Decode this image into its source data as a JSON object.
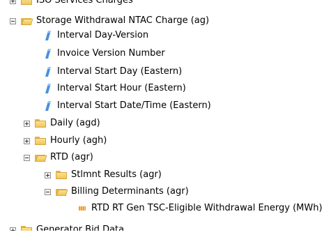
{
  "tree": {
    "top_partial": "ISO Services Charges",
    "storage_folder": "Storage Withdrawal NTAC Charge (ag)",
    "attributes": [
      "Interval Day-Version",
      "Invoice Version Number",
      "Interval Start Day (Eastern)",
      "Interval Start Hour (Eastern)",
      "Interval Start Date/Time (Eastern)"
    ],
    "daily": "Daily (agd)",
    "hourly": "Hourly (agh)",
    "rtd": "RTD (agr)",
    "stlmnt": "Stlmnt Results (agr)",
    "billing": "Billing Determinants (agr)",
    "measure": "RTD RT Gen TSC-Eligible Withdrawal Energy (MWh)",
    "bottom_partial": "Generator Bid Data"
  },
  "colors": {
    "folder": "#f1c55d",
    "attribute": "#4a8fe0",
    "measure": "#f39a2a"
  }
}
